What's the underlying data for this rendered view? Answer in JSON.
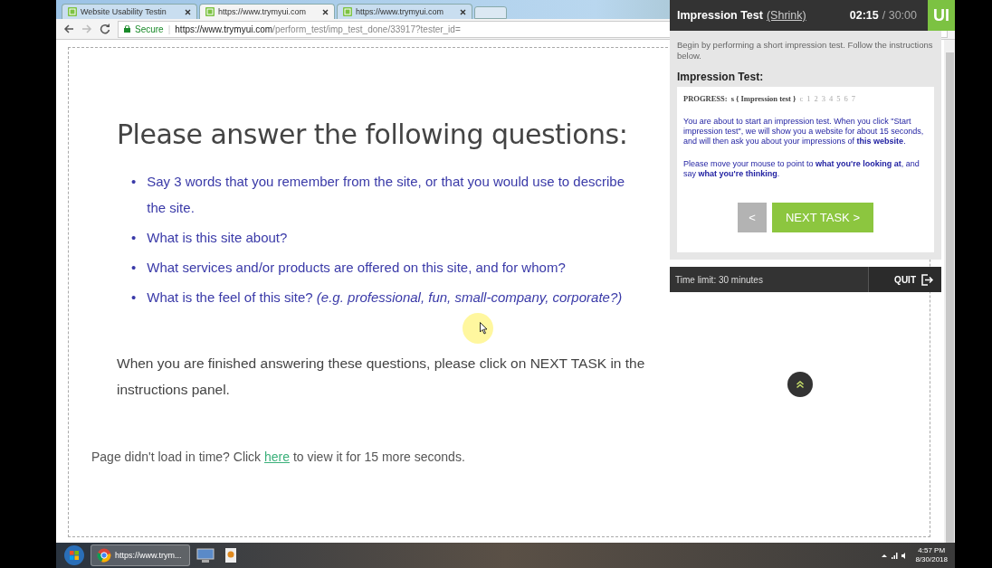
{
  "browser": {
    "tabs": [
      {
        "title": "Website Usability Testin",
        "selected": false
      },
      {
        "title": "https://www.trymyui.com",
        "selected": true
      },
      {
        "title": "https://www.trymyui.com",
        "selected": false
      }
    ],
    "address": {
      "secure_label": "Secure",
      "separator": "|",
      "host": "https://www.trymyui.com",
      "path": "/perform_test/imp_test_done/33917?tester_id="
    }
  },
  "page": {
    "heading": "Please answer the following questions:",
    "questions": [
      {
        "marker": "•",
        "text": "Say 3 words that you remember from the site, or that you would use to describe the site."
      },
      {
        "marker": "•",
        "text": "What is this site about?"
      },
      {
        "marker": "•",
        "text": "What services and/or products are offered on this site, and for whom?"
      },
      {
        "marker": "•",
        "text": "What is the feel of this site? *(e.g. professional, fun, small-company, corporate?)*"
      }
    ],
    "finish_note": "When you are finished answering these questions, please click on NEXT TASK in the instructions panel.",
    "reload_note": {
      "before": "Page didn't load in time? Click ",
      "link": "here",
      "after": " to view it for 15 more seconds."
    }
  },
  "panel": {
    "title": "Impression Test",
    "shrink_link": "(Shrink)",
    "elapsed": "02:15",
    "limit": "/ 30:00",
    "logo": "UI",
    "intro": "Begin by performing a short impression test. Follow the instructions below.",
    "section_title": "Impression Test:",
    "progress": {
      "label": "PROGRESS:",
      "current": "s { Impression test }",
      "upcoming": [
        "c",
        "1",
        "2",
        "3",
        "4",
        "5",
        "6",
        "7"
      ]
    },
    "paragraphs": [
      "You are about to start an impression test. When you click \"Start impression test\", we will show you a website for about 15 seconds, and will then ask you about your impressions of **this website**.",
      "Please move your mouse to point to **what you're looking at**, and say **what you're thinking**."
    ],
    "buttons": [
      {
        "label": "<",
        "disabled": true
      },
      {
        "label": "NEXT TASK >",
        "disabled": false
      }
    ],
    "time_limit": "Time limit: 30 minutes",
    "quit": "QUIT"
  },
  "taskbar": {
    "tasks": [
      {
        "label": "https://www.trym..."
      }
    ],
    "time": "4:57 PM",
    "date": "8/30/2018"
  }
}
